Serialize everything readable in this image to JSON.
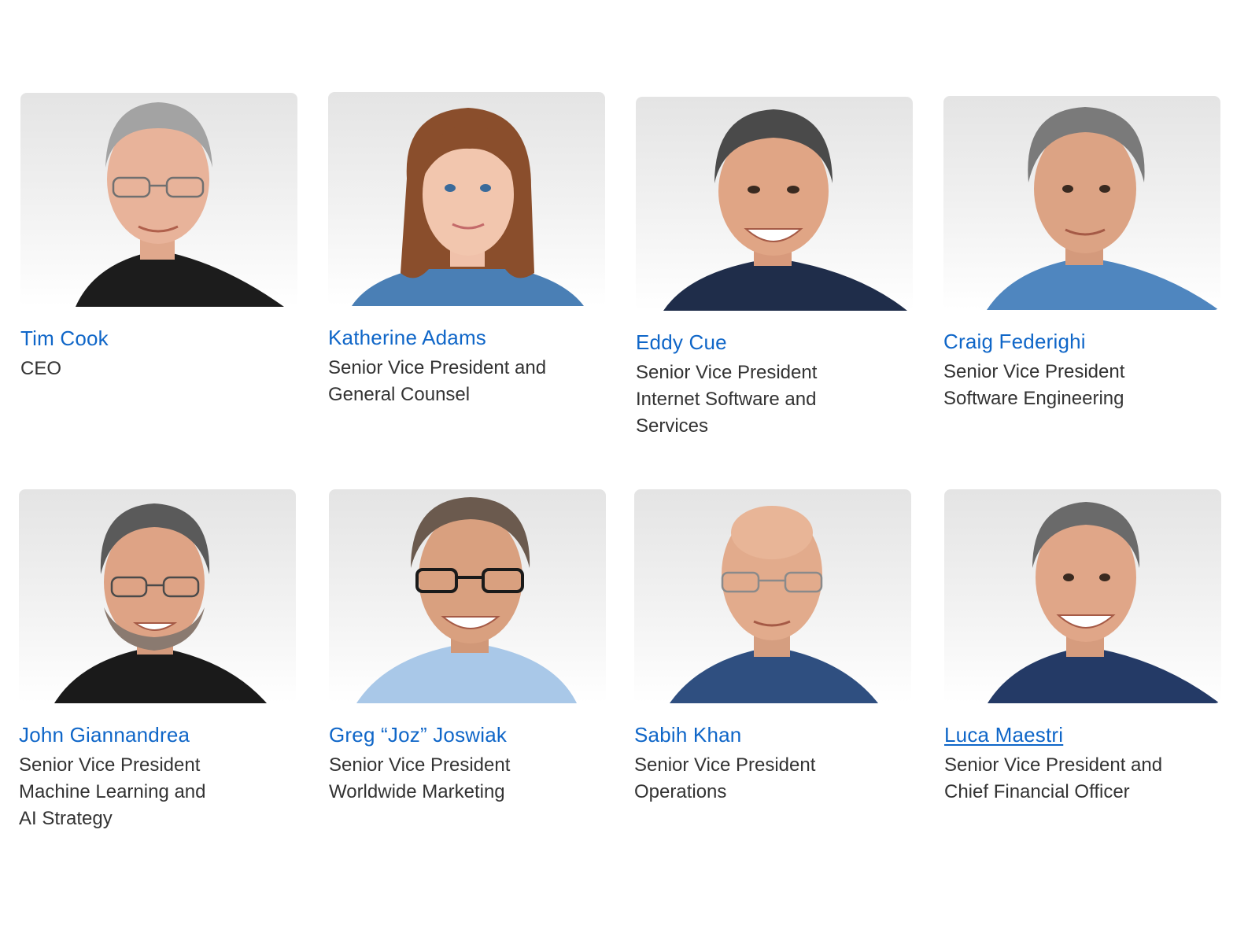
{
  "colors": {
    "link": "#0f66c8",
    "text": "#333333",
    "photo_bg_top": "#e4e4e4",
    "photo_bg_bottom": "#ffffff"
  },
  "people": [
    {
      "name": "Tim Cook",
      "role_lines": [
        "CEO"
      ],
      "underlined": false
    },
    {
      "name": "Katherine Adams",
      "role_lines": [
        "Senior Vice President and",
        "General Counsel"
      ],
      "underlined": false
    },
    {
      "name": "Eddy Cue",
      "role_lines": [
        "Senior Vice President",
        "Internet Software and",
        "Services"
      ],
      "underlined": false
    },
    {
      "name": "Craig Federighi",
      "role_lines": [
        "Senior Vice President",
        "Software Engineering"
      ],
      "underlined": false
    },
    {
      "name": "John Giannandrea",
      "role_lines": [
        "Senior Vice President",
        "Machine Learning and",
        "AI Strategy"
      ],
      "underlined": false
    },
    {
      "name": "Greg “Joz” Joswiak",
      "role_lines": [
        "Senior Vice President",
        "Worldwide Marketing"
      ],
      "underlined": false
    },
    {
      "name": "Sabih Khan",
      "role_lines": [
        "Senior Vice President",
        "Operations"
      ],
      "underlined": false
    },
    {
      "name": "Luca Maestri",
      "role_lines": [
        "Senior Vice President and",
        "Chief Financial Officer"
      ],
      "underlined": true
    }
  ]
}
